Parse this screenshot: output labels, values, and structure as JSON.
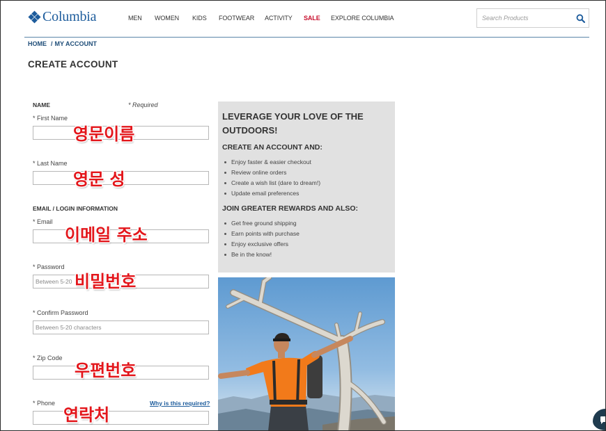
{
  "colors": {
    "brand_blue": "#1d5c9c",
    "sale_red": "#c8102e",
    "breadcrumb_blue": "#1e4d78",
    "annotation_red": "#e3161b",
    "panel_gray": "#e1e1e1",
    "chat_navy": "#1f3b4e"
  },
  "header": {
    "logo": {
      "icon": "columbia-diamond-icon",
      "text": "Columbia"
    },
    "nav": [
      {
        "label": "MEN"
      },
      {
        "label": "WOMEN"
      },
      {
        "label": "KIDS"
      },
      {
        "label": "FOOTWEAR"
      },
      {
        "label": "ACTIVITY"
      },
      {
        "label": "SALE",
        "highlighted": true
      },
      {
        "label": "EXPLORE COLUMBIA"
      }
    ],
    "search": {
      "placeholder": "Search Products",
      "value": "",
      "icon": "search-icon"
    }
  },
  "breadcrumb": {
    "home": "HOME",
    "separator": "/",
    "current": "MY ACCOUNT"
  },
  "page_title": "CREATE ACCOUNT",
  "form": {
    "name_section": "NAME",
    "required_note": "* Required",
    "email_section": "EMAIL / LOGIN INFORMATION",
    "fields": {
      "first_name": {
        "label": "* First Name",
        "value": ""
      },
      "last_name": {
        "label": "* Last Name",
        "value": ""
      },
      "email": {
        "label": "* Email",
        "value": ""
      },
      "password": {
        "label": "* Password",
        "placeholder": "Between 5-20"
      },
      "confirm_password": {
        "label": "* Confirm Password",
        "placeholder": "Between 5-20 characters"
      },
      "zip_code": {
        "label": "* Zip Code",
        "value": ""
      },
      "phone": {
        "label": "* Phone",
        "value": "",
        "help_link": "Why is this required?"
      }
    }
  },
  "annotations": [
    "영문이름",
    "영문 성",
    "이메일 주소",
    "비밀번호",
    "우편번호",
    "연락처"
  ],
  "promo": {
    "heading": "LEVERAGE YOUR LOVE OF THE OUTDOORS!",
    "create_heading": "CREATE AN ACCOUNT AND:",
    "create_items": [
      "Enjoy faster & easier checkout",
      "Review online orders",
      "Create a wish list (dare to dream!)",
      "Update email preferences"
    ],
    "rewards_heading": "JOIN GREATER REWARDS AND ALSO:",
    "rewards_items": [
      "Get free ground shipping",
      "Earn points with purchase",
      "Enjoy exclusive offers",
      "Be in the know!"
    ]
  },
  "chat": {
    "icon": "chat-icon"
  }
}
